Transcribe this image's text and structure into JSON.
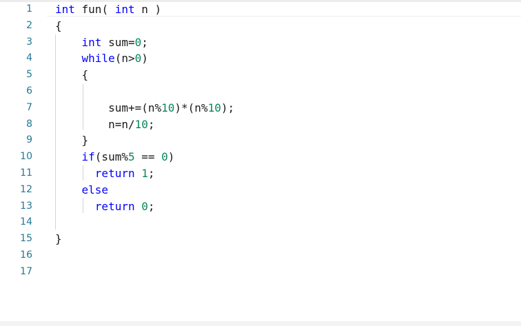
{
  "editor": {
    "colors": {
      "keyword": "#0000ff",
      "number": "#098658",
      "text": "#1a1a1a",
      "line_number": "#237893"
    },
    "line_numbers": [
      "1",
      "2",
      "3",
      "4",
      "5",
      "6",
      "7",
      "8",
      "9",
      "10",
      "11",
      "12",
      "13",
      "14",
      "15",
      "16",
      "17"
    ],
    "lines": [
      [
        {
          "t": "int",
          "c": "kw"
        },
        {
          "t": " fun( ",
          "c": "txt"
        },
        {
          "t": "int",
          "c": "kw"
        },
        {
          "t": " n )",
          "c": "txt"
        }
      ],
      [
        {
          "t": "{",
          "c": "txt"
        }
      ],
      [
        {
          "t": "    ",
          "c": "txt"
        },
        {
          "t": "int",
          "c": "kw"
        },
        {
          "t": " sum=",
          "c": "txt"
        },
        {
          "t": "0",
          "c": "num"
        },
        {
          "t": ";",
          "c": "txt"
        }
      ],
      [
        {
          "t": "    ",
          "c": "txt"
        },
        {
          "t": "while",
          "c": "kw"
        },
        {
          "t": "(n>",
          "c": "txt"
        },
        {
          "t": "0",
          "c": "num"
        },
        {
          "t": ")",
          "c": "txt"
        }
      ],
      [
        {
          "t": "    {",
          "c": "txt"
        }
      ],
      [],
      [
        {
          "t": "        sum+=(n%",
          "c": "txt"
        },
        {
          "t": "10",
          "c": "num"
        },
        {
          "t": ")*(n%",
          "c": "txt"
        },
        {
          "t": "10",
          "c": "num"
        },
        {
          "t": ");",
          "c": "txt"
        }
      ],
      [
        {
          "t": "        n=n/",
          "c": "txt"
        },
        {
          "t": "10",
          "c": "num"
        },
        {
          "t": ";",
          "c": "txt"
        }
      ],
      [
        {
          "t": "    }",
          "c": "txt"
        }
      ],
      [
        {
          "t": "    ",
          "c": "txt"
        },
        {
          "t": "if",
          "c": "kw"
        },
        {
          "t": "(sum%",
          "c": "txt"
        },
        {
          "t": "5",
          "c": "num"
        },
        {
          "t": " == ",
          "c": "txt"
        },
        {
          "t": "0",
          "c": "num"
        },
        {
          "t": ")",
          "c": "txt"
        }
      ],
      [
        {
          "t": "      ",
          "c": "txt"
        },
        {
          "t": "return",
          "c": "kw"
        },
        {
          "t": " ",
          "c": "txt"
        },
        {
          "t": "1",
          "c": "num"
        },
        {
          "t": ";",
          "c": "txt"
        }
      ],
      [
        {
          "t": "    ",
          "c": "txt"
        },
        {
          "t": "else",
          "c": "kw"
        }
      ],
      [
        {
          "t": "      ",
          "c": "txt"
        },
        {
          "t": "return",
          "c": "kw"
        },
        {
          "t": " ",
          "c": "txt"
        },
        {
          "t": "0",
          "c": "num"
        },
        {
          "t": ";",
          "c": "txt"
        }
      ],
      [],
      [
        {
          "t": "}",
          "c": "txt"
        }
      ],
      [],
      []
    ]
  }
}
